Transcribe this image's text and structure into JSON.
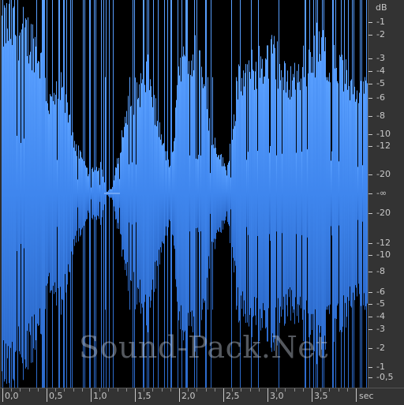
{
  "waveform": {
    "color_top": "#4f95ff",
    "color_bottom": "#2f6fcf",
    "background": "#000000"
  },
  "watermark": "Sound-Pack.Net",
  "db_ruler": {
    "unit": "dB",
    "labels": [
      "-1",
      "-2",
      "-3",
      "-4",
      "-5",
      "-6",
      "-8",
      "-10",
      "-12",
      "-20",
      "-∞",
      "-20",
      "-12",
      "-10",
      "-8",
      "-6",
      "-5",
      "-4",
      "-3",
      "-2",
      "-1",
      "-0,5"
    ]
  },
  "time_ruler": {
    "labels": [
      "0,0",
      "0,5",
      "1,0",
      "1,5",
      "2,0",
      "2,5",
      "3,0",
      "3,5"
    ],
    "unit": "sec"
  }
}
